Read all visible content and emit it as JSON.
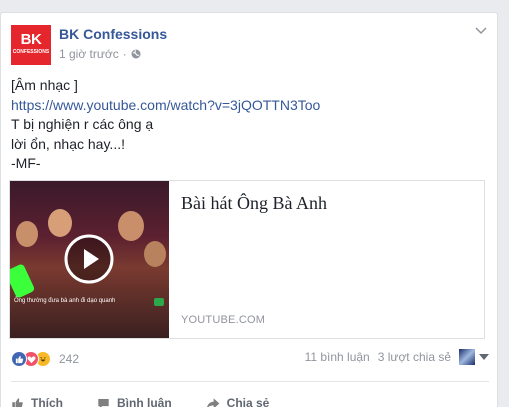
{
  "post": {
    "page_name": "BK Confessions",
    "avatar_text_top": "BK",
    "avatar_text_bottom": "CONFESSIONS",
    "time": "1 giờ trước",
    "time_separator": "·",
    "lines": [
      "[Âm nhạc ]",
      "https://www.youtube.com/watch?v=3jQOTTN3Too",
      "T bị nghiện r các ông ạ",
      "lời ổn, nhạc hay...!",
      "-MF-"
    ]
  },
  "link_preview": {
    "title": "Bài hát Ông Bà Anh",
    "domain": "YOUTUBE.COM",
    "thumb_caption": "Ông thường đưa bà anh đi dạo quanh"
  },
  "stats": {
    "reaction_count": "242",
    "comments": "11 bình luận",
    "shares": "3 lượt chia sẻ"
  },
  "actions": {
    "like": "Thích",
    "comment": "Bình luận",
    "share": "Chia sẻ"
  },
  "colors": {
    "link": "#365899",
    "brand_red": "#e5262c",
    "like_blue": "#4267b2",
    "love_red": "#f25268",
    "haha_yellow": "#f7b928"
  }
}
